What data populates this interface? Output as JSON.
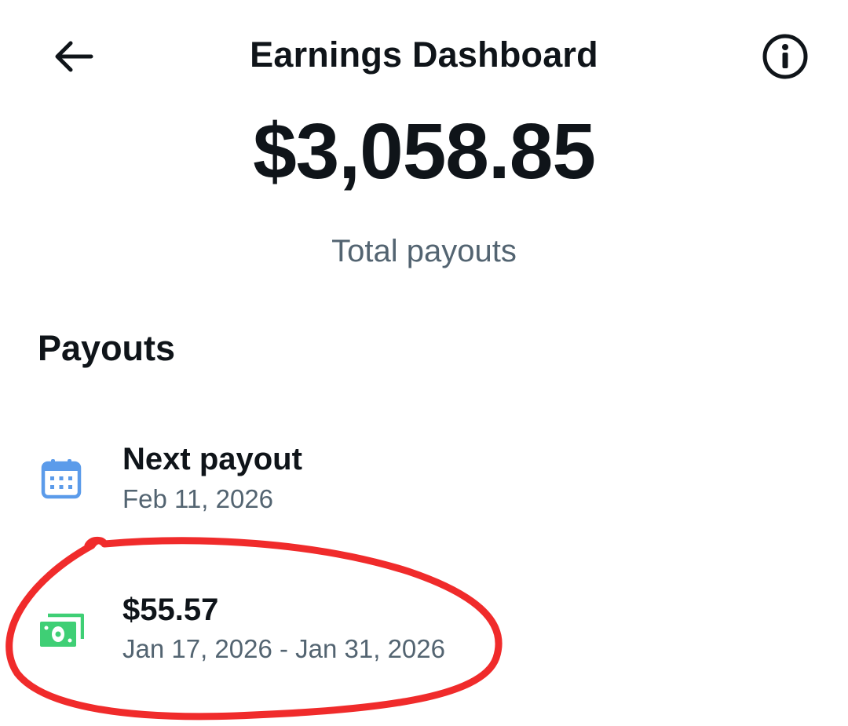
{
  "header": {
    "title": "Earnings Dashboard",
    "back_icon": "arrow-left-icon",
    "info_icon": "info-icon"
  },
  "summary": {
    "total_amount": "$3,058.85",
    "total_label": "Total payouts"
  },
  "payouts": {
    "section_title": "Payouts",
    "next_payout": {
      "icon": "calendar-icon",
      "icon_color": "#5b9bea",
      "title": "Next payout",
      "date": "Feb 11, 2026"
    },
    "items": [
      {
        "icon": "money-icon",
        "icon_color": "#3fcf75",
        "amount": "$55.57",
        "period": "Jan 17, 2026 - Jan 31, 2026"
      }
    ]
  },
  "annotation": {
    "type": "hand-drawn-circle",
    "color": "#f02b2b"
  }
}
